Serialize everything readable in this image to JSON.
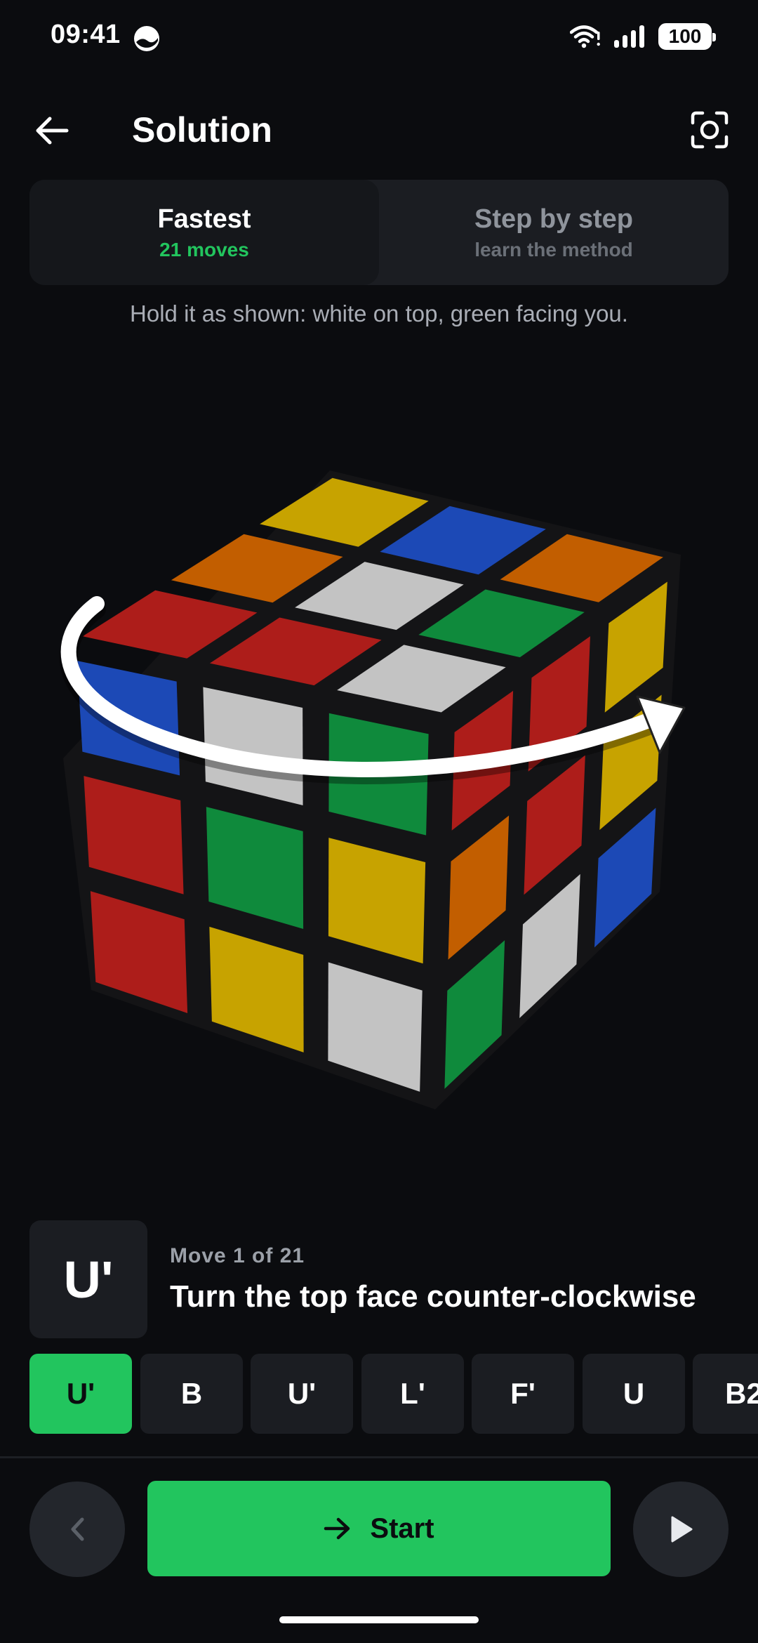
{
  "status": {
    "time": "09:41",
    "battery": "100"
  },
  "header": {
    "title": "Solution",
    "back_icon": "arrow-left-icon",
    "scan_icon": "camera-scan-icon"
  },
  "tabs": [
    {
      "label": "Fastest",
      "sublabel": "21 moves",
      "active": true
    },
    {
      "label": "Step by step",
      "sublabel": "learn the method",
      "active": false
    }
  ],
  "hint": "Hold it as shown: white on top, green facing you.",
  "cube": {
    "rotation_arrow": "U' counter-clockwise (top layer)",
    "colors": {
      "red": "#ad1d1a",
      "orange": "#c25e00",
      "yellow": "#c7a300",
      "green": "#0f8a3c",
      "blue": "#1c49b6",
      "white": "#c3c3c3",
      "body": "#141416"
    }
  },
  "current_move": {
    "notation": "U'",
    "counter": "Move 1 of 21",
    "description": "Turn the top face counter-clockwise"
  },
  "moves": [
    "U'",
    "B",
    "U'",
    "L'",
    "F'",
    "U",
    "B2"
  ],
  "controls": {
    "start_label": "Start",
    "prev_icon": "chevron-left-icon",
    "play_icon": "play-icon",
    "start_icon": "arrow-right-icon"
  },
  "colors": {
    "accent": "#22c55e",
    "background": "#0b0c0f",
    "surface": "#1b1d22"
  }
}
